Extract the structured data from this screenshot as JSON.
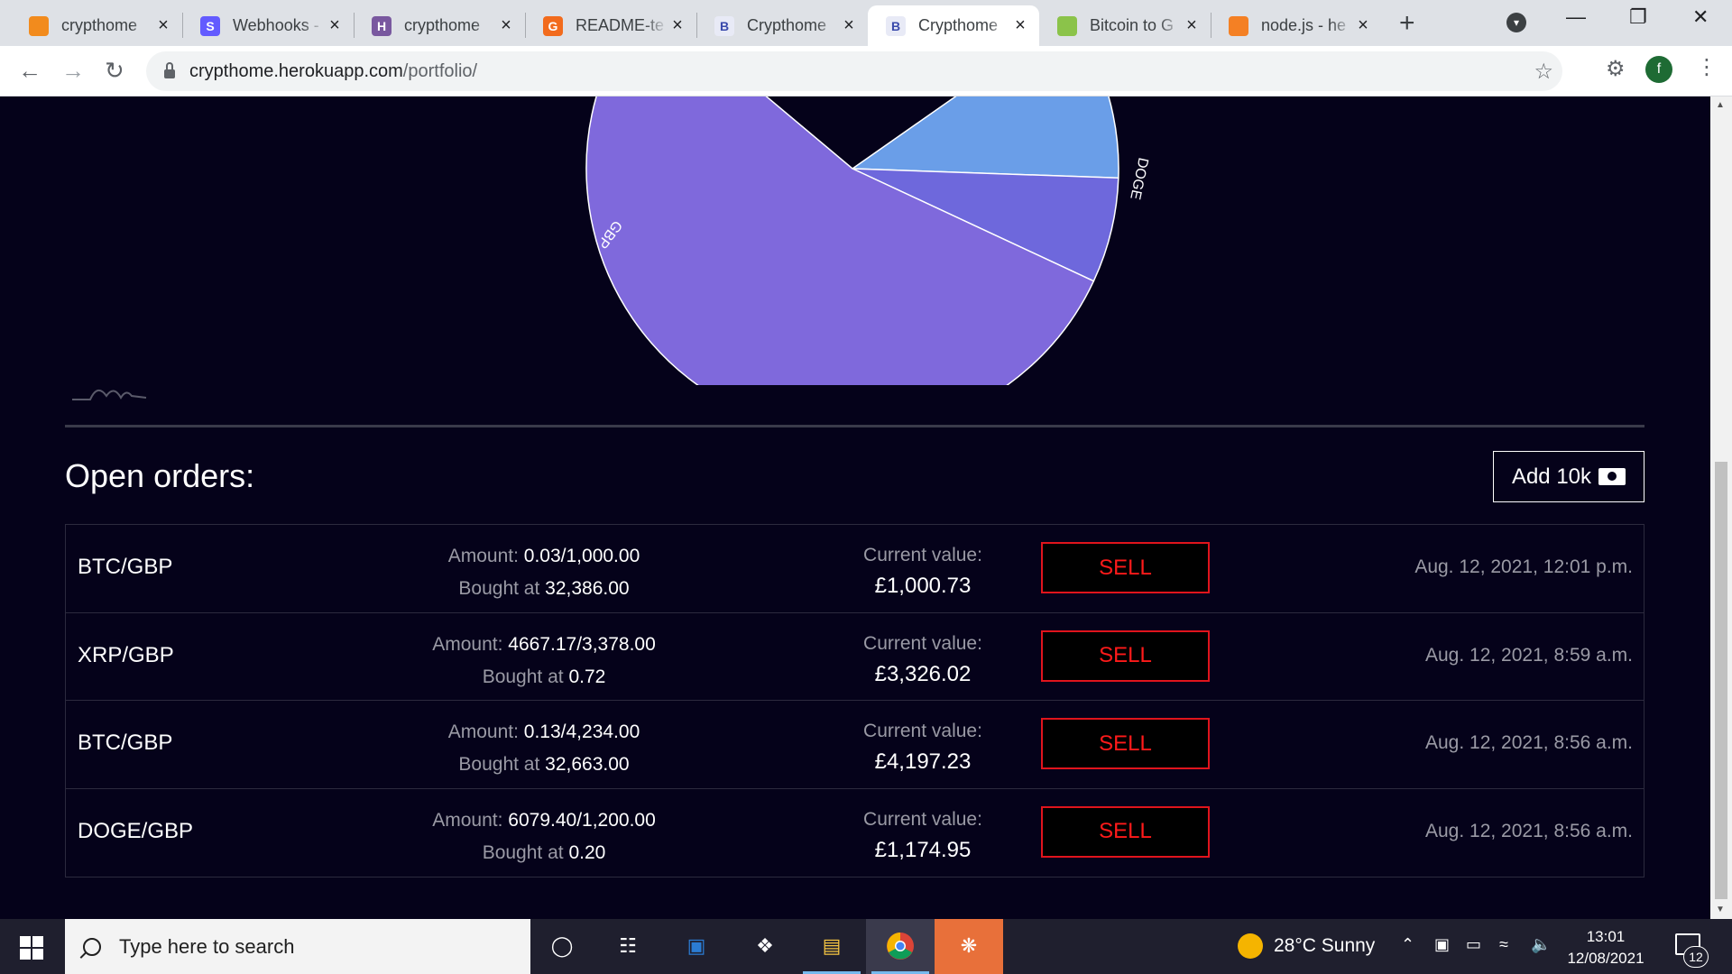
{
  "browser": {
    "tabs": [
      {
        "title": "crypthome",
        "favicon": "orange-cube-icon",
        "color": "#f28b1d",
        "glyph": "",
        "active": false
      },
      {
        "title": "Webhooks -",
        "favicon": "stripe-s-icon",
        "color": "#635bff",
        "glyph": "S",
        "active": false
      },
      {
        "title": "crypthome",
        "favicon": "heroku-h-icon",
        "color": "#79589f",
        "glyph": "H",
        "active": false
      },
      {
        "title": "README-te",
        "favicon": "readme-g-icon",
        "color": "#f26b1d",
        "glyph": "G",
        "active": false
      },
      {
        "title": "Crypthome",
        "favicon": "crypthome-b-icon",
        "color": "#e8eaf6",
        "glyph": "B",
        "active": false
      },
      {
        "title": "Crypthome",
        "favicon": "crypthome-b-icon",
        "color": "#e8eaf6",
        "glyph": "B",
        "active": true
      },
      {
        "title": "Bitcoin to G",
        "favicon": "bitcoin-converter-icon",
        "color": "#8bc34a",
        "glyph": "",
        "active": false
      },
      {
        "title": "node.js - he",
        "favicon": "stackoverflow-icon",
        "color": "#f48024",
        "glyph": "",
        "active": false
      }
    ],
    "url_host": "crypthome.herokuapp.com",
    "url_path": "/portfolio/",
    "profile_initial": "f"
  },
  "chart_data": {
    "type": "pie",
    "slice_labels": [
      "GBP",
      "DOGE"
    ],
    "slice_colors": [
      "#7f69dc",
      "#6e68dc",
      "#6a9ee8"
    ],
    "stroke_color": "#ffffff"
  },
  "orders_section": {
    "title": "Open orders:",
    "add_button": "Add 10k",
    "amount_label": "Amount:",
    "bought_label": "Bought at",
    "current_value_label": "Current value:",
    "sell_label": "SELL"
  },
  "orders": [
    {
      "pair": "BTC/GBP",
      "amount": "0.03/1,000.00",
      "bought_at": "32,386.00",
      "current_value": "£1,000.73",
      "date": "Aug. 12, 2021, 12:01 p.m."
    },
    {
      "pair": "XRP/GBP",
      "amount": "4667.17/3,378.00",
      "bought_at": "0.72",
      "current_value": "£3,326.02",
      "date": "Aug. 12, 2021, 8:59 a.m."
    },
    {
      "pair": "BTC/GBP",
      "amount": "0.13/4,234.00",
      "bought_at": "32,663.00",
      "current_value": "£4,197.23",
      "date": "Aug. 12, 2021, 8:56 a.m."
    },
    {
      "pair": "DOGE/GBP",
      "amount": "6079.40/1,200.00",
      "bought_at": "0.20",
      "current_value": "£1,174.95",
      "date": "Aug. 12, 2021, 8:56 a.m."
    }
  ],
  "taskbar": {
    "search_placeholder": "Type here to search",
    "weather": "28°C  Sunny",
    "time": "13:01",
    "date": "12/08/2021",
    "notification_count": "12"
  }
}
